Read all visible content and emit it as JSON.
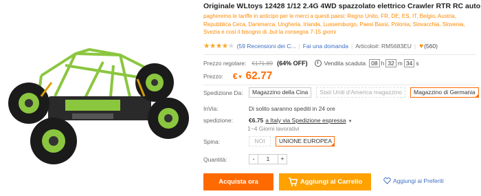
{
  "product": {
    "title": "Originale WLtoys 12428 1/12 2.4G 4WD spazzolato elettrico Crawler RTR RC auto",
    "notice": "pagheremo le tariffe in anticipo per le merci a questi paesi: Regno Unito, FR, DE, ES, IT, Belgio, Austria, Repubblica Ceca, Danimarca, Ungheria, Irlanda, Lussemburgo, Paesi Bassi, Polonia, Slovacchia, Slovenia, Svezia e così il bisogno di .but la consegna 7-15 giorni",
    "image_alt": "RC crawler car green"
  },
  "rating": {
    "stars": 4,
    "reviews_link": "(59 Recensioni dei C...",
    "question_link": "Fai una domanda",
    "sku_label": "Articolo#: RM5683EU",
    "favorites": "(560)"
  },
  "pricing": {
    "regular_label": "Prezzo regolare:",
    "regular_price": "€171.89",
    "discount": "(64% OFF)",
    "flash_label": "Vendita scaduta",
    "hours": "08",
    "hours_unit": "h",
    "minutes": "32",
    "minutes_unit": "m",
    "seconds": "34",
    "seconds_unit": "s",
    "price_label": "Prezzo:",
    "currency": "€",
    "price": "62.77"
  },
  "shipping_from": {
    "label": "Spedizione Da:",
    "options": [
      {
        "label": "Magazzino della Cina",
        "state": "normal"
      },
      {
        "label": "Stati Uniti d'America magazzino",
        "state": "disabled"
      },
      {
        "label": "Magazzino di Germania",
        "state": "selected"
      }
    ]
  },
  "invia": {
    "label": "InVia:",
    "value": "Di solito saranno spediti in 24 ore"
  },
  "shipping": {
    "label": "spedizione:",
    "price": "€6.75",
    "via": "a Italy via Spedizione espressa",
    "days": "1~4 Giorni lavorativi"
  },
  "plug": {
    "label": "Spina:",
    "options": [
      {
        "label": "NOI",
        "state": "disabled"
      },
      {
        "label": "UNIONE EUROPEA",
        "state": "selected"
      }
    ]
  },
  "quantity": {
    "label": "Quantità:",
    "minus": "-",
    "value": "1",
    "plus": "+"
  },
  "actions": {
    "buy_label": "Acquista ora",
    "cart_label": "Aggiungi al Carrello",
    "wishlist_label": "Aggiungi ai Preferiti"
  },
  "colors": {
    "accent": "#ff6a00",
    "cart": "#ffa200",
    "notice": "#ff8a00",
    "link": "#3d6fc4"
  }
}
